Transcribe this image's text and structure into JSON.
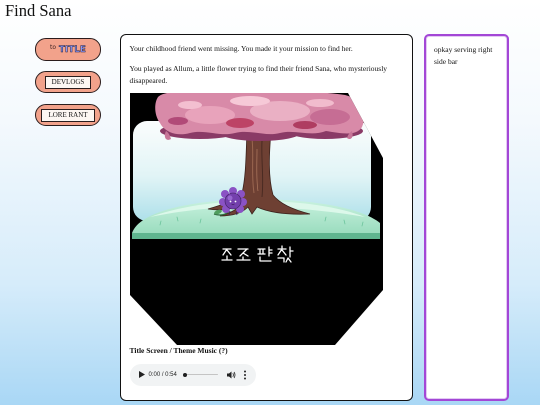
{
  "page": {
    "title": "Find Sana"
  },
  "nav": {
    "title_button": {
      "prefix": "to",
      "label": "TITLE"
    },
    "devlogs_label": "DEVLOGS",
    "lore_label": "LORE RANT"
  },
  "main": {
    "intro": [
      "Your childhood friend went missing. You made it your mission to find her.",
      "You played as Allum, a little flower trying to find their friend Sana, who mysteriously disappeared."
    ],
    "media": {
      "caption": "Title Screen / Theme Music (?)",
      "audio": {
        "time_display": "0:00 / 0:54",
        "progress": 0,
        "icons": {
          "play": "play-icon",
          "volume": "volume-icon",
          "more": "more-options-icon"
        }
      }
    }
  },
  "sidebar": {
    "text": "opkay serving right side bar"
  },
  "colors": {
    "nav_button_fill": "#f2a28b",
    "title_button_text": "#8f9bff",
    "sidebar_border": "#a347d6",
    "audio_player_bg": "#f1f3f4"
  }
}
